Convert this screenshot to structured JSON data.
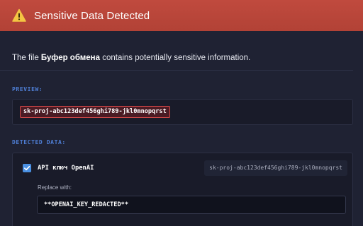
{
  "dialog": {
    "title": "Sensitive Data Detected",
    "icon": "warning-icon",
    "accent_color": "#b24236"
  },
  "intro": {
    "prefix": "The file ",
    "file_name": "Буфер обмена",
    "suffix": " contains potentially sensitive information."
  },
  "preview": {
    "label": "PREVIEW:",
    "text": "sk-proj-abc123def456ghi789-jkl0mnopqrst"
  },
  "detected": {
    "label": "DETECTED DATA:",
    "items": [
      {
        "checked": true,
        "name": "API ключ OpenAI",
        "value": "sk-proj-abc123def456ghi789-jkl0mnopqrst",
        "replace_label": "Replace with:",
        "replace_value": "**OPENAI_KEY_REDACTED**"
      }
    ]
  }
}
